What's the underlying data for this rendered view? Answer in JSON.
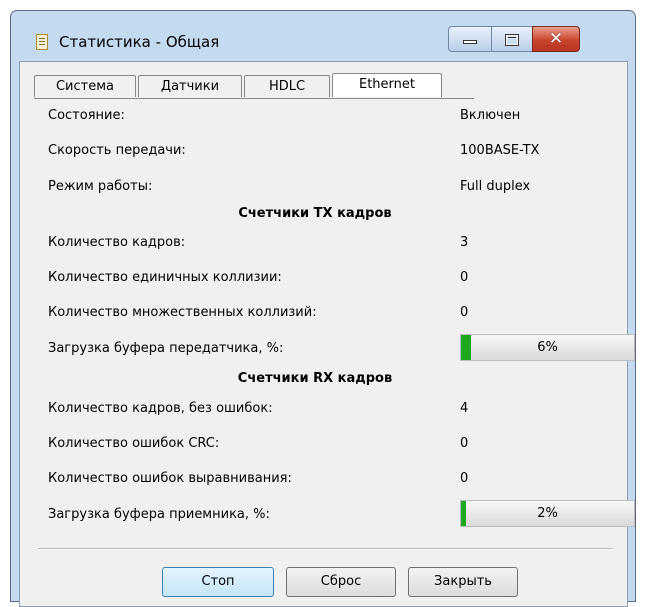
{
  "window": {
    "title": "Статистика - Общая"
  },
  "tabs": [
    {
      "label": "Система"
    },
    {
      "label": "Датчики"
    },
    {
      "label": "HDLC"
    },
    {
      "label": "Ethernet"
    }
  ],
  "general": [
    {
      "label": "Состояние:",
      "value": "Включен"
    },
    {
      "label": "Скорость передачи:",
      "value": "100BASE-TX"
    },
    {
      "label": "Режим работы:",
      "value": "Full duplex"
    }
  ],
  "tx": {
    "header": "Счетчики TX кадров",
    "rows": [
      {
        "label": "Количество кадров:",
        "value": "3"
      },
      {
        "label": "Количество единичных коллизии:",
        "value": "0"
      },
      {
        "label": "Количество множественных коллизий:",
        "value": "0"
      }
    ],
    "buffer": {
      "label": "Загрузка буфера передатчика, %:",
      "text": "6%",
      "percent": 6
    }
  },
  "rx": {
    "header": "Счетчики RX кадров",
    "rows": [
      {
        "label": "Количество кадров, без ошибок:",
        "value": "4"
      },
      {
        "label": "Количество ошибок CRC:",
        "value": "0"
      },
      {
        "label": "Количество ошибок выравнивания:",
        "value": "0"
      }
    ],
    "buffer": {
      "label": "Загрузка буфера приемника, %:",
      "text": "2%",
      "percent": 2
    }
  },
  "buttons": {
    "stop": "Стоп",
    "reset": "Сброс",
    "close": "Закрыть"
  },
  "colors": {
    "progress": "#1ea81e",
    "titlebar": "#c4daf0",
    "close_button": "#c9452f"
  }
}
